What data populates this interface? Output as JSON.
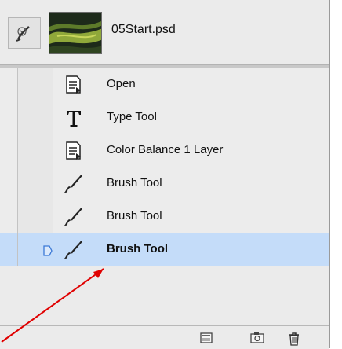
{
  "history_panel": {
    "snapshot": {
      "name": "05Start.psd",
      "brush_source_icon": "history-brush-icon",
      "thumbnail_icon": "document-thumbnail"
    },
    "states": [
      {
        "label": "Open",
        "icon": "document-icon"
      },
      {
        "label": "Type Tool",
        "icon": "type-tool-icon"
      },
      {
        "label": "Color Balance 1 Layer",
        "icon": "document-icon"
      },
      {
        "label": "Brush Tool",
        "icon": "brush-icon"
      },
      {
        "label": "Brush Tool",
        "icon": "brush-icon"
      },
      {
        "label": "Brush Tool",
        "icon": "brush-icon",
        "selected": true
      }
    ],
    "footer_buttons": [
      {
        "icon": "new-document-from-state-icon"
      },
      {
        "icon": "new-snapshot-icon"
      },
      {
        "icon": "delete-state-icon"
      }
    ],
    "colors": {
      "selected_row": "#c4dcf9",
      "annotation_arrow": "#e00000"
    }
  }
}
